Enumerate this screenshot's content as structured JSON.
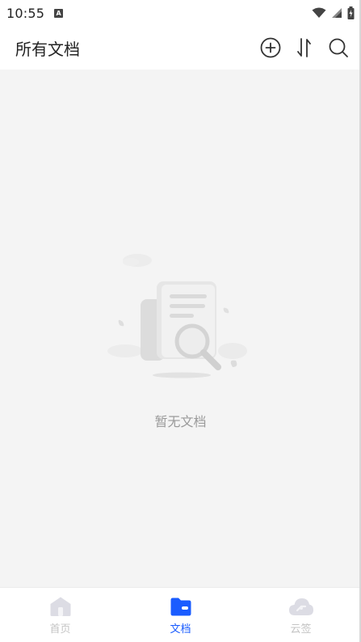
{
  "status_bar": {
    "time": "10:55",
    "notification_icon": "a-icon",
    "icons": [
      "wifi-icon",
      "signal-icon",
      "battery-icon"
    ]
  },
  "app_bar": {
    "title": "所有文档",
    "actions": [
      "add-circle-icon",
      "sort-icon",
      "search-icon"
    ]
  },
  "empty_state": {
    "illustration": "document-search-illustration",
    "text": "暂无文档"
  },
  "tab_bar": {
    "tabs": [
      {
        "label": "首页",
        "icon": "home-icon",
        "active": false
      },
      {
        "label": "文档",
        "icon": "folder-icon",
        "active": true
      },
      {
        "label": "云签",
        "icon": "cloud-sign-icon",
        "active": false
      }
    ]
  },
  "colors": {
    "accent": "#1a5cff",
    "inactive": "#c4c4c4",
    "background": "#f4f4f4"
  }
}
